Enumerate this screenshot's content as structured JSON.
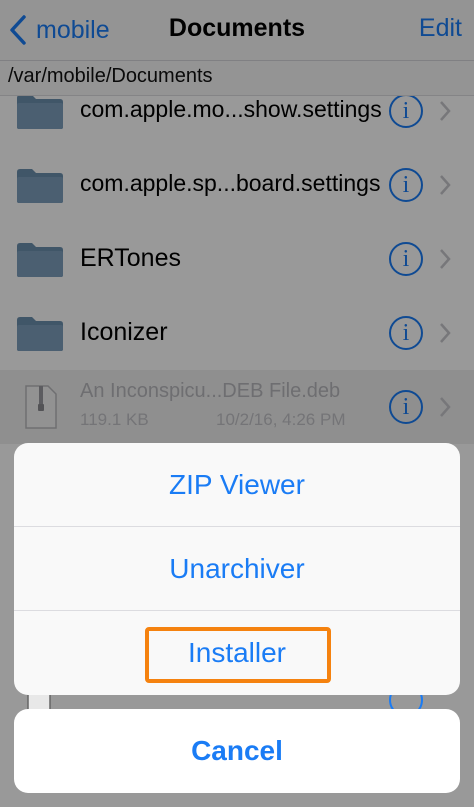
{
  "navbar": {
    "back_label": "mobile",
    "title": "Documents",
    "edit_label": "Edit"
  },
  "path": "/var/mobile/Documents",
  "files": [
    {
      "name": "com.apple.mo...show.settings",
      "type": "folder"
    },
    {
      "name": "com.apple.sp...board.settings",
      "type": "folder"
    },
    {
      "name": "ERTones",
      "type": "folder"
    },
    {
      "name": "Iconizer",
      "type": "folder"
    },
    {
      "name": "An Inconspicu...DEB File.deb",
      "type": "file",
      "size": "119.1 KB",
      "date": "10/2/16, 4:26 PM"
    }
  ],
  "action_sheet": {
    "options": [
      "ZIP Viewer",
      "Unarchiver",
      "Installer"
    ],
    "highlighted": "Installer",
    "cancel_label": "Cancel"
  },
  "colors": {
    "accent": "#1a7cf5",
    "highlight": "#f5820f",
    "folder": "#6b8fae"
  },
  "icons": {
    "back": "chevron-left-icon",
    "folder": "folder-icon",
    "file": "document-icon",
    "info": "info-circle-icon",
    "disclosure": "chevron-right-icon"
  }
}
